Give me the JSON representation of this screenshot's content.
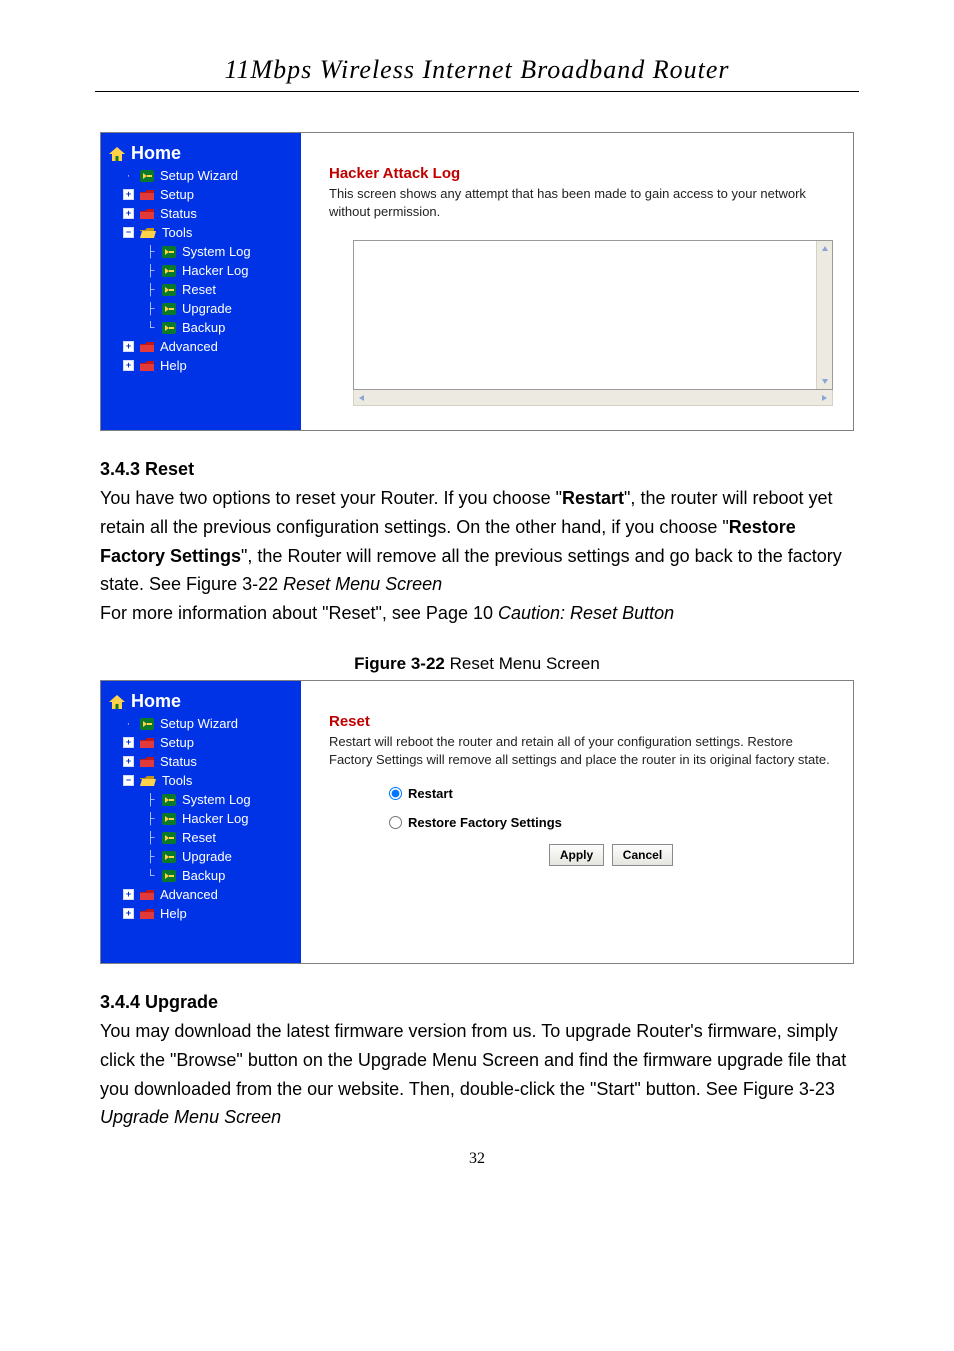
{
  "page_number": "32",
  "header_title": "11Mbps  Wireless  Internet  Broadband  Router",
  "sidebar": {
    "home": "Home",
    "items": [
      {
        "label": "Setup Wizard",
        "ctrl": "dot",
        "icon": "arrow",
        "lvl": 1
      },
      {
        "label": "Setup",
        "ctrl": "plus",
        "icon": "folder-red",
        "lvl": 1
      },
      {
        "label": "Status",
        "ctrl": "plus",
        "icon": "folder-red",
        "lvl": 1
      },
      {
        "label": "Tools",
        "ctrl": "minus",
        "icon": "folder-open",
        "lvl": 1
      },
      {
        "label": "System Log",
        "ctrl": "bar",
        "icon": "arrow",
        "lvl": 2
      },
      {
        "label": "Hacker Log",
        "ctrl": "bar",
        "icon": "arrow",
        "lvl": 2
      },
      {
        "label": "Reset",
        "ctrl": "bar",
        "icon": "arrow",
        "lvl": 2
      },
      {
        "label": "Upgrade",
        "ctrl": "bar",
        "icon": "arrow",
        "lvl": 2
      },
      {
        "label": "Backup",
        "ctrl": "end",
        "icon": "arrow",
        "lvl": 2
      },
      {
        "label": "Advanced",
        "ctrl": "plus",
        "icon": "folder-red",
        "lvl": 1
      },
      {
        "label": "Help",
        "ctrl": "plus",
        "icon": "folder-red",
        "lvl": 1
      }
    ]
  },
  "panel_hacker": {
    "title": "Hacker Attack Log",
    "desc": "This screen shows any attempt that has been made to gain access to your network without permission."
  },
  "section_reset": {
    "heading": "3.4.3 Reset",
    "t1a": "You have two options to reset your Router. If you choose \"",
    "t1b": "Restart",
    "t1c": "\", the router will reboot yet retain all the previous configuration settings. On the other hand, if you choose \"",
    "t1d": "Restore Factory Settings",
    "t1e": "\", the Router will remove all the previous settings and go back to the factory state. See Figure 3-22 ",
    "t1f": "Reset Menu Screen",
    "t2": "For more information about \"Reset\", see Page 10 ",
    "t2i": "Caution: Reset Button"
  },
  "fig22": {
    "label_bold": "Figure 3-22",
    "label_rest": " Reset Menu Screen"
  },
  "panel_reset": {
    "title": "Reset",
    "desc": "Restart will reboot the router and retain all of your configuration settings. Restore Factory Settings will remove all settings and place the router in its original factory state.",
    "opt_restart": "Restart",
    "opt_restore": "Restore Factory Settings",
    "btn_apply": "Apply",
    "btn_cancel": "Cancel"
  },
  "section_upgrade": {
    "heading": "3.4.4 Upgrade",
    "body": "You may download the latest firmware version from us. To upgrade Router's firmware, simply click the \"Browse\" button on the Upgrade Menu Screen and find the firmware upgrade file that you downloaded from the our website. Then, double-click the \"Start\" button. See Figure 3-23 ",
    "body_i": "Upgrade Menu Screen"
  }
}
